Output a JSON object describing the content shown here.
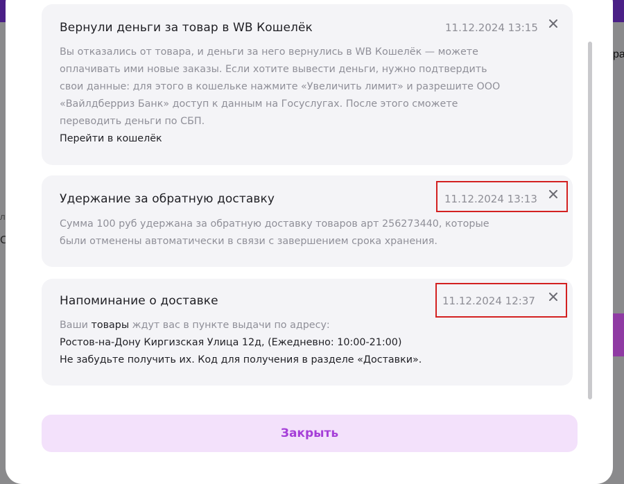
{
  "background": {
    "right_text": "ра",
    "left_text_1": "л",
    "left_text_2": "С"
  },
  "notifications": [
    {
      "title": "Вернули деньги за товар в WB Кошелёк",
      "date": "11.12.2024 13:15",
      "body_lines": [
        "Вы отказались от товара, и деньги за него вернулись в WB Кошелёк — можете",
        "оплачивать ими новые заказы. Если хотите вывести деньги, нужно подтвердить",
        "свои данные: для этого в кошельке нажмите «Увеличить лимит» и разрешите ООО",
        "«Вайлдберриз Банк» доступ к данным на Госуслугах. После этого сможете",
        "переводить деньги по СБП."
      ],
      "link": "Перейти в кошелёк"
    },
    {
      "title": "Удержание за обратную доставку",
      "date": "11.12.2024 13:13",
      "body_lines": [
        "Сумма 100 руб удержана за обратную доставку товаров арт 256273440, которые",
        "были отменены автоматически в связи с завершением срока хранения."
      ]
    },
    {
      "title": "Напоминание о доставке",
      "date": "11.12.2024 12:37",
      "body_prefix": "Ваши ",
      "body_highlight": "товары",
      "body_suffix": " ждут вас в пункте выдачи по адресу:",
      "address": "Ростов-на-Дону Киргизская Улица 12д, (Ежедневно: 10:00-21:00)",
      "note": "Не забудьте получить их. Код для получения в разделе «Доставки»."
    }
  ],
  "close_button": "Закрыть",
  "colors": {
    "accent": "#a53ed8",
    "button_bg": "#f3e1fb",
    "card_bg": "#f4f4f7",
    "highlight_box": "#d32020"
  }
}
